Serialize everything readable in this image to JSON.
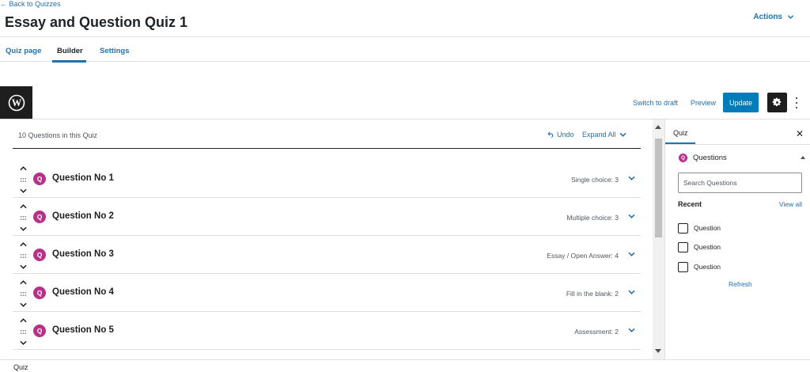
{
  "header": {
    "back_link": "← Back to Quizzes",
    "title": "Essay and Question Quiz 1",
    "actions_label": "Actions"
  },
  "tabs": [
    {
      "label": "Quiz page",
      "active": false
    },
    {
      "label": "Builder",
      "active": true
    },
    {
      "label": "Settings",
      "active": false
    }
  ],
  "toolbar": {
    "logo_icon": "wordpress-icon",
    "switch_to_draft": "Switch to draft",
    "preview": "Preview",
    "update": "Update",
    "settings_icon": "gear-icon",
    "more_icon": "more-vertical-icon"
  },
  "builder": {
    "count_text": "10 Questions in this Quiz",
    "undo_label": "Undo",
    "expand_label": "Expand All",
    "badge_letter": "Q",
    "questions": [
      {
        "title": "Question No 1",
        "type": "Single choice: 3"
      },
      {
        "title": "Question No 2",
        "type": "Multiple choice: 3"
      },
      {
        "title": "Question No 3",
        "type": "Essay / Open Answer: 4"
      },
      {
        "title": "Question No 4",
        "type": "Fill in the blank: 2"
      },
      {
        "title": "Question No 5",
        "type": "Assessment: 2"
      }
    ]
  },
  "sidebar": {
    "tab_label": "Quiz",
    "close_icon": "close-icon",
    "panel_title": "Questions",
    "search_placeholder": "Search Questions",
    "recent_label": "Recent",
    "view_all": "View all",
    "recent_items": [
      "Question",
      "Question",
      "Question"
    ],
    "refresh": "Refresh"
  },
  "footer": {
    "breadcrumb": "Quiz"
  },
  "colors": {
    "accent": "#2271b1",
    "primary_button": "#007cba",
    "badge": "#b7318b",
    "dark": "#1e1e1e"
  }
}
